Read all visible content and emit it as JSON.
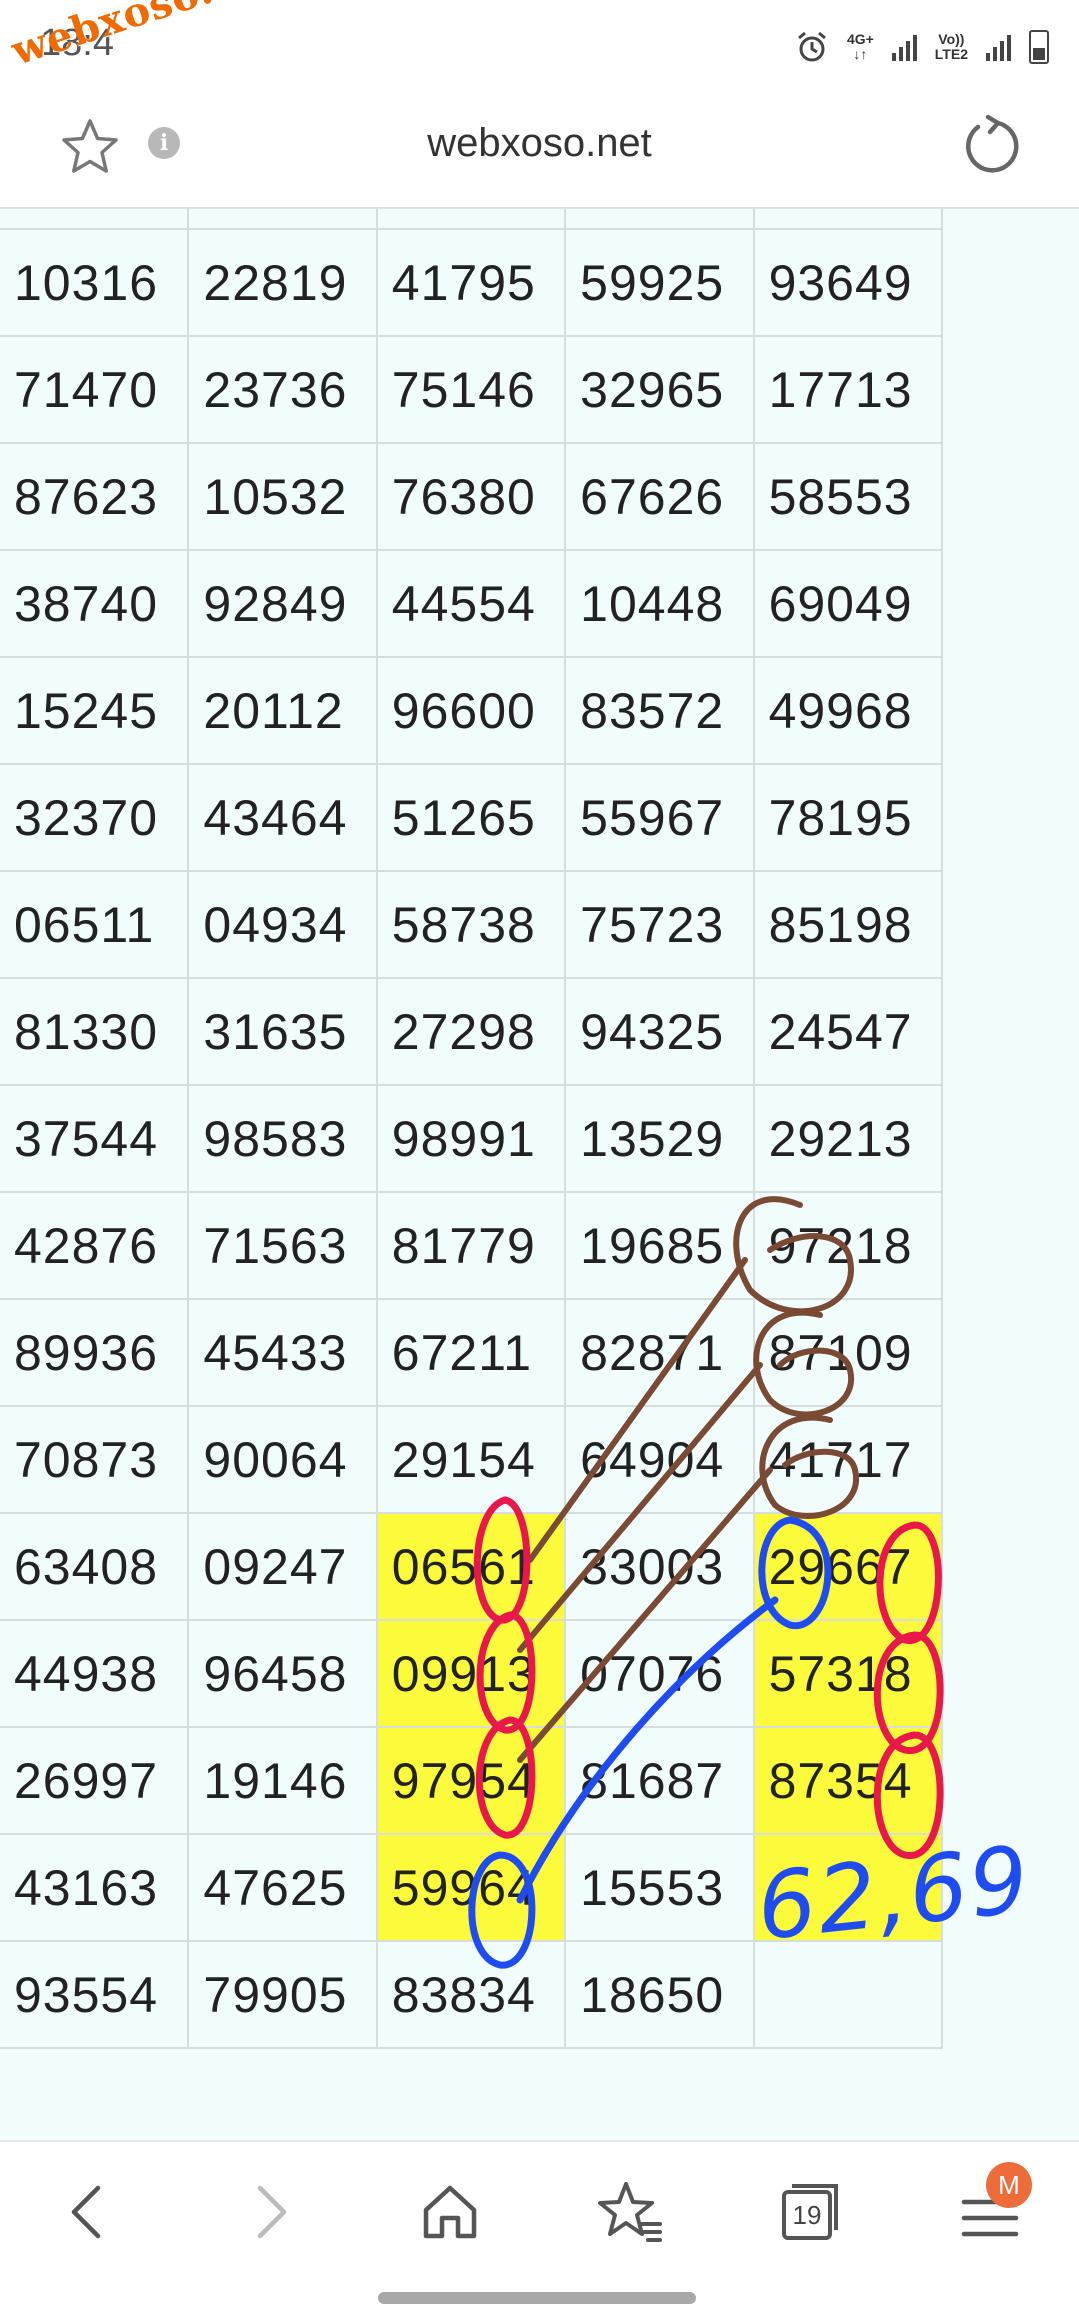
{
  "status_bar": {
    "time": "18:4",
    "watermark": "webxoso.net",
    "network_top": "4G+",
    "volte_line1": "Vo))",
    "volte_line2": "LTE2",
    "icons": [
      "alarm-icon",
      "signal-icon",
      "signal-icon",
      "battery-icon"
    ]
  },
  "address_bar": {
    "url": "webxoso.net",
    "info_symbol": "i",
    "icons": [
      "bookmark-star-icon",
      "info-icon",
      "reload-icon"
    ]
  },
  "table": {
    "rows": [
      [
        "10316",
        "22819",
        "41795",
        "59925",
        "93649"
      ],
      [
        "71470",
        "23736",
        "75146",
        "32965",
        "17713"
      ],
      [
        "87623",
        "10532",
        "76380",
        "67626",
        "58553"
      ],
      [
        "38740",
        "92849",
        "44554",
        "10448",
        "69049"
      ],
      [
        "15245",
        "20112",
        "96600",
        "83572",
        "49968"
      ],
      [
        "32370",
        "43464",
        "51265",
        "55967",
        "78195"
      ],
      [
        "06511",
        "04934",
        "58738",
        "75723",
        "85198"
      ],
      [
        "81330",
        "31635",
        "27298",
        "94325",
        "24547"
      ],
      [
        "37544",
        "98583",
        "98991",
        "13529",
        "29213"
      ],
      [
        "42876",
        "71563",
        "81779",
        "19685",
        "97218"
      ],
      [
        "89936",
        "45433",
        "67211",
        "82871",
        "87109"
      ],
      [
        "70873",
        "90064",
        "29154",
        "64904",
        "41717"
      ],
      [
        "63408",
        "09247",
        "06561",
        "33003",
        "29667"
      ],
      [
        "44938",
        "96458",
        "09913",
        "07076",
        "57318"
      ],
      [
        "26997",
        "19146",
        "97954",
        "81687",
        "87354"
      ],
      [
        "43163",
        "47625",
        "59964",
        "15553",
        ""
      ],
      [
        "93554",
        "79905",
        "83834",
        "18650",
        ""
      ]
    ],
    "highlight_color": "#fbfb3c"
  },
  "annotation": {
    "handwritten_text": "62,69",
    "colors": {
      "brown": "#7a4a34",
      "red": "#e8194a",
      "blue": "#1f4cf0"
    }
  },
  "bottom_nav": {
    "tabs_count": "19",
    "menu_badge": "M",
    "icons": [
      "back-icon",
      "forward-icon",
      "home-icon",
      "bookmarks-icon",
      "tabs-icon",
      "menu-icon"
    ]
  }
}
